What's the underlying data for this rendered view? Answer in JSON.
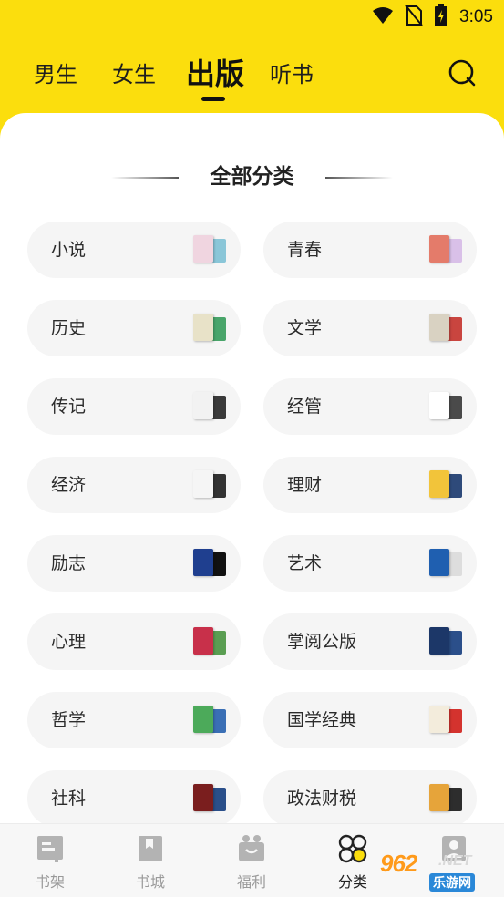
{
  "status_bar": {
    "time": "3:05"
  },
  "top_tabs": [
    {
      "label": "男生",
      "active": false
    },
    {
      "label": "女生",
      "active": false
    },
    {
      "label": "出版",
      "active": true
    },
    {
      "label": "听书",
      "active": false
    }
  ],
  "section": {
    "title": "全部分类"
  },
  "categories": [
    {
      "label": "小说",
      "cover_colors": [
        "#f0d5e0",
        "#8ac6d8"
      ]
    },
    {
      "label": "青春",
      "cover_colors": [
        "#e47b6a",
        "#d9c0e8"
      ]
    },
    {
      "label": "历史",
      "cover_colors": [
        "#e8e2c8",
        "#49a56a"
      ]
    },
    {
      "label": "文学",
      "cover_colors": [
        "#d9d2c2",
        "#c9453f"
      ]
    },
    {
      "label": "传记",
      "cover_colors": [
        "#f2f2f2",
        "#3a3a3a"
      ]
    },
    {
      "label": "经管",
      "cover_colors": [
        "#ffffff",
        "#4a4a4a"
      ]
    },
    {
      "label": "经济",
      "cover_colors": [
        "#f5f5f5",
        "#333333"
      ]
    },
    {
      "label": "理财",
      "cover_colors": [
        "#f2c43a",
        "#2e4a7a"
      ]
    },
    {
      "label": "励志",
      "cover_colors": [
        "#1f3f8f",
        "#111111"
      ]
    },
    {
      "label": "艺术",
      "cover_colors": [
        "#1f5fb0",
        "#dddddd"
      ]
    },
    {
      "label": "心理",
      "cover_colors": [
        "#c8304a",
        "#5a9e52"
      ]
    },
    {
      "label": "掌阅公版",
      "cover_colors": [
        "#1c3768",
        "#2b4f8a"
      ]
    },
    {
      "label": "哲学",
      "cover_colors": [
        "#4caa5a",
        "#3a6fb5"
      ]
    },
    {
      "label": "国学经典",
      "cover_colors": [
        "#f3ecdc",
        "#d4332e"
      ]
    },
    {
      "label": "社科",
      "cover_colors": [
        "#7a1e1e",
        "#2a4f8a"
      ]
    },
    {
      "label": "政法财税",
      "cover_colors": [
        "#e6a43a",
        "#2d2d2d"
      ]
    }
  ],
  "bottom_nav": [
    {
      "label": "书架",
      "icon": "bookshelf-icon",
      "active": false
    },
    {
      "label": "书城",
      "icon": "bookstore-icon",
      "active": false
    },
    {
      "label": "福利",
      "icon": "gift-icon",
      "active": false
    },
    {
      "label": "分类",
      "icon": "category-icon",
      "active": true
    },
    {
      "label": "我的",
      "icon": "profile-icon",
      "active": false
    }
  ],
  "watermark": {
    "number": "962",
    "suffix": ".NET",
    "subtitle": "乐游网"
  },
  "colors": {
    "brand_yellow": "#fbde0d",
    "pill_bg": "#f5f5f5",
    "text_dark": "#2b2b2b",
    "nav_inactive": "#9a9a9a"
  }
}
